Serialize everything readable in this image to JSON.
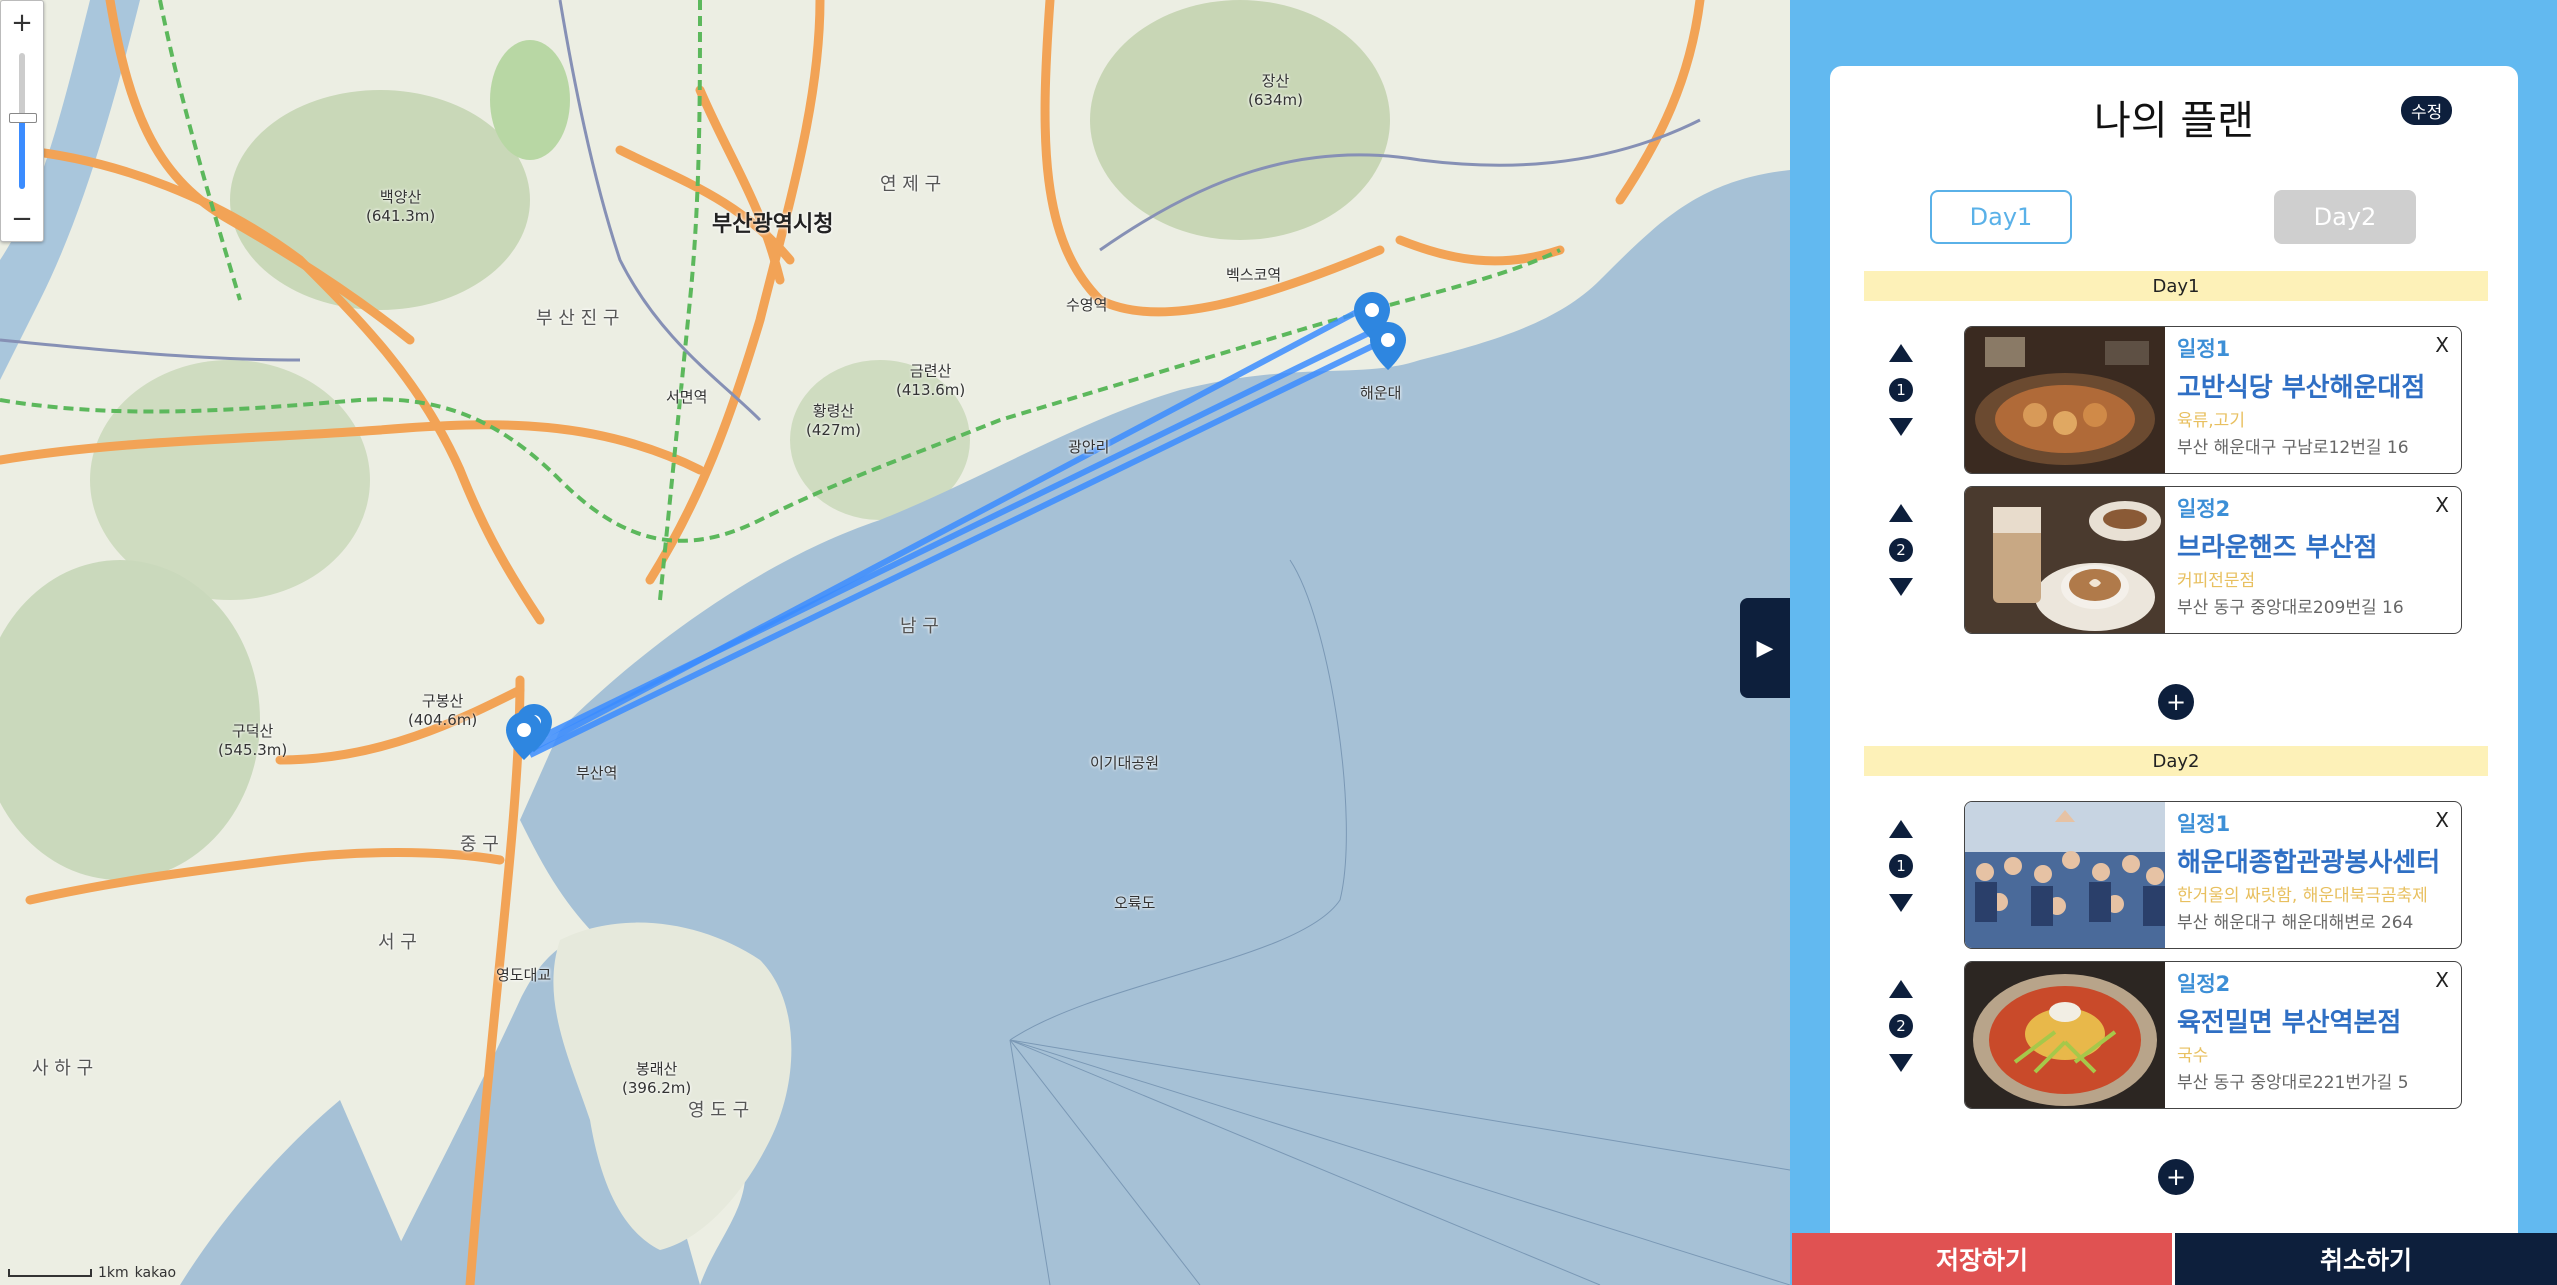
{
  "map": {
    "zoom_in": "+",
    "zoom_out": "−",
    "toggle": "▶",
    "attribution": "kakao",
    "scale_label": "1km",
    "labels": {
      "city_hall": "부산광역시청",
      "yeonje": "연 제 구",
      "busanjin": "부 산 진 구",
      "nam": "남 구",
      "jung": "중 구",
      "seo": "서 구",
      "saha": "사 하 구",
      "yeongdo": "영 도 구",
      "haeundae": "해운대",
      "jangsan": "장산\n(634m)",
      "baekyangsan": "백양산\n(641.3m)",
      "hwangnyeongsan": "황령산\n(427m)",
      "geumryeonsan": "금련산\n(413.6m)",
      "gubongsan": "구봉산\n(404.6m)",
      "gudeoksan": "구덕산\n(545.3m)",
      "bongraesan": "봉래산\n(396.2m)",
      "oryukdo": "오륙도",
      "igidae": "이기대공원",
      "busan_station": "부산역",
      "seomyeon": "서면역",
      "suyeong": "수영역",
      "centum": "벡스코역",
      "gwangan": "광안리",
      "yeongdo_bridge": "영도대교"
    }
  },
  "panel": {
    "title": "나의 플랜",
    "edit": "수정",
    "tabs": [
      "Day1",
      "Day2"
    ],
    "days": [
      {
        "header": "Day1",
        "items": [
          {
            "label": "일정1",
            "order": "1",
            "name": "고반식당 부산해운대점",
            "category": "육류,고기",
            "address": "부산 해운대구 구남로12번길 16",
            "close": "X"
          },
          {
            "label": "일정2",
            "order": "2",
            "name": "브라운핸즈 부산점",
            "category": "커피전문점",
            "address": "부산 동구 중앙대로209번길 16",
            "close": "X"
          }
        ],
        "add": "+"
      },
      {
        "header": "Day2",
        "items": [
          {
            "label": "일정1",
            "order": "1",
            "name": "해운대종합관광봉사센터",
            "category": "한거울의 짜릿함, 해운대북극곰축제",
            "address": "부산 해운대구 해운대해변로 264",
            "close": "X"
          },
          {
            "label": "일정2",
            "order": "2",
            "name": "육전밀면 부산역본점",
            "category": "국수",
            "address": "부산 동구 중앙대로221번가길 5",
            "close": "X"
          }
        ],
        "add": "+"
      }
    ],
    "save": "저장하기",
    "cancel": "취소하기"
  },
  "colors": {
    "panel_bg": "#62b9f0",
    "navy": "#0d1f3c",
    "save": "#e05252",
    "route": "#3b8cff",
    "day_header": "#fdf1b8"
  }
}
